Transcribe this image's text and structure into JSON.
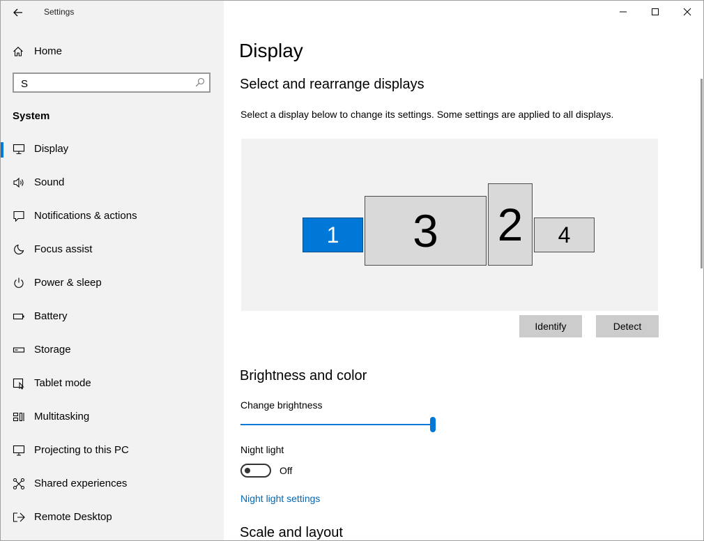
{
  "window": {
    "title": "Settings"
  },
  "sidebar": {
    "home_label": "Home",
    "search_value": "S",
    "section": "System",
    "items": [
      {
        "label": "Display",
        "icon": "monitor-icon",
        "active": true
      },
      {
        "label": "Sound",
        "icon": "speaker-icon"
      },
      {
        "label": "Notifications & actions",
        "icon": "notification-icon"
      },
      {
        "label": "Focus assist",
        "icon": "moon-icon"
      },
      {
        "label": "Power & sleep",
        "icon": "power-icon"
      },
      {
        "label": "Battery",
        "icon": "battery-icon"
      },
      {
        "label": "Storage",
        "icon": "storage-icon"
      },
      {
        "label": "Tablet mode",
        "icon": "tablet-icon"
      },
      {
        "label": "Multitasking",
        "icon": "multitasking-icon"
      },
      {
        "label": "Projecting to this PC",
        "icon": "projector-icon"
      },
      {
        "label": "Shared experiences",
        "icon": "shared-icon"
      },
      {
        "label": "Remote Desktop",
        "icon": "remote-desktop-icon"
      }
    ]
  },
  "main": {
    "title": "Display",
    "arrange_heading": "Select and rearrange displays",
    "arrange_desc": "Select a display below to change its settings. Some settings are applied to all displays.",
    "monitors": [
      "1",
      "3",
      "2",
      "4"
    ],
    "selected_monitor": "1",
    "identify_label": "Identify",
    "detect_label": "Detect",
    "brightness_heading": "Brightness and color",
    "brightness_label": "Change brightness",
    "brightness_value": 100,
    "night_light_label": "Night light",
    "night_light_state": "Off",
    "night_light_settings_link": "Night light settings",
    "scale_heading": "Scale and layout"
  },
  "colors": {
    "accent": "#0078d7",
    "link": "#0067b8",
    "sidebar_bg": "#f2f2f2"
  }
}
